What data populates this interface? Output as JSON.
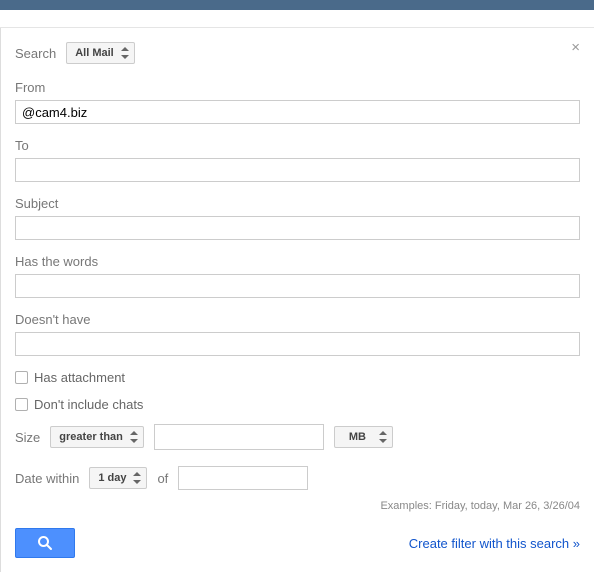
{
  "top": {
    "search_label": "Search",
    "scope_selected": "All Mail"
  },
  "fields": {
    "from": {
      "label": "From",
      "value": "@cam4.biz"
    },
    "to": {
      "label": "To",
      "value": ""
    },
    "subject": {
      "label": "Subject",
      "value": ""
    },
    "has_words": {
      "label": "Has the words",
      "value": ""
    },
    "doesnt_have": {
      "label": "Doesn't have",
      "value": ""
    }
  },
  "checkboxes": {
    "has_attachment": "Has attachment",
    "dont_include_chats": "Don't include chats"
  },
  "size": {
    "label": "Size",
    "operator": "greater than",
    "value": "",
    "unit": "MB"
  },
  "date": {
    "label": "Date within",
    "range": "1 day",
    "of_label": "of",
    "value": ""
  },
  "examples": "Examples: Friday, today, Mar 26, 3/26/04",
  "footer": {
    "create_filter": "Create filter with this search »"
  }
}
